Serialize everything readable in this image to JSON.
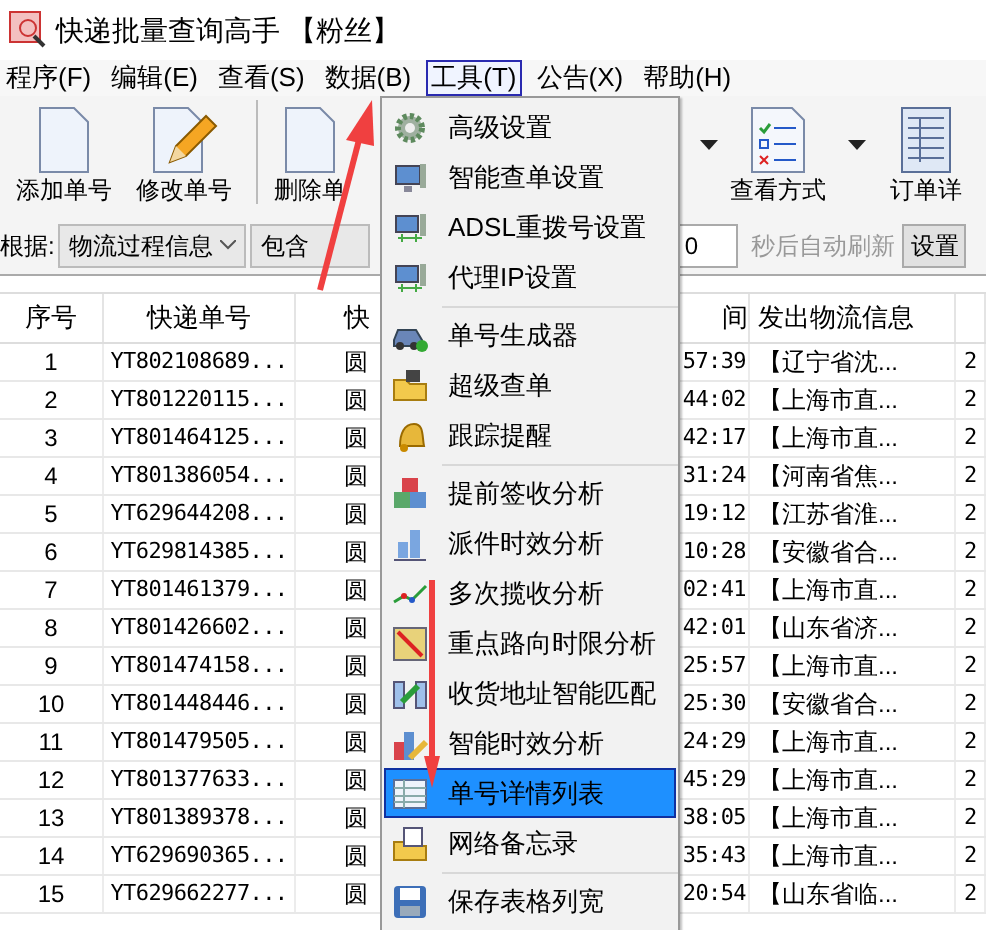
{
  "window": {
    "title": "快递批量查询高手 【粉丝】"
  },
  "menubar": [
    {
      "label": "程序(F)",
      "selected": false
    },
    {
      "label": "编辑(E)",
      "selected": false
    },
    {
      "label": "查看(S)",
      "selected": false
    },
    {
      "label": "数据(B)",
      "selected": false
    },
    {
      "label": "工具(T)",
      "selected": true
    },
    {
      "label": "公告(X)",
      "selected": false
    },
    {
      "label": "帮助(H)",
      "selected": false
    }
  ],
  "toolbar": [
    {
      "kind": "add",
      "label": "添加单号"
    },
    {
      "kind": "edit",
      "label": "修改单号"
    },
    {
      "kind": "sep"
    },
    {
      "kind": "delete",
      "label": "删除单"
    },
    {
      "kind": "caret"
    },
    {
      "kind": "view",
      "label": "查看方式"
    },
    {
      "kind": "caret"
    },
    {
      "kind": "detail",
      "label": "订单详"
    }
  ],
  "filter": {
    "label": "根据:",
    "field": "物流过程信息",
    "match": "包含",
    "seconds": "0",
    "refresh_label": "秒后自动刷新",
    "button": "设置"
  },
  "table": {
    "columns": [
      "序号",
      "快递单号",
      "快",
      "间",
      "发出物流信息",
      ""
    ],
    "rows": [
      [
        "1",
        "YT802108689...",
        "圆",
        "57:39",
        "【辽宁省沈...",
        "2"
      ],
      [
        "2",
        "YT801220115...",
        "圆",
        "44:02",
        "【上海市直...",
        "2"
      ],
      [
        "3",
        "YT801464125...",
        "圆",
        "42:17",
        "【上海市直...",
        "2"
      ],
      [
        "4",
        "YT801386054...",
        "圆",
        "31:24",
        "【河南省焦...",
        "2"
      ],
      [
        "5",
        "YT629644208...",
        "圆",
        "19:12",
        "【江苏省淮...",
        "2"
      ],
      [
        "6",
        "YT629814385...",
        "圆",
        "10:28",
        "【安徽省合...",
        "2"
      ],
      [
        "7",
        "YT801461379...",
        "圆",
        "02:41",
        "【上海市直...",
        "2"
      ],
      [
        "8",
        "YT801426602...",
        "圆",
        "42:01",
        "【山东省济...",
        "2"
      ],
      [
        "9",
        "YT801474158...",
        "圆",
        "25:57",
        "【上海市直...",
        "2"
      ],
      [
        "10",
        "YT801448446...",
        "圆",
        "25:30",
        "【安徽省合...",
        "2"
      ],
      [
        "11",
        "YT801479505...",
        "圆",
        "24:29",
        "【上海市直...",
        "2"
      ],
      [
        "12",
        "YT801377633...",
        "圆",
        "45:29",
        "【上海市直...",
        "2"
      ],
      [
        "13",
        "YT801389378...",
        "圆",
        "38:05",
        "【上海市直...",
        "2"
      ],
      [
        "14",
        "YT629690365...",
        "圆",
        "35:43",
        "【上海市直...",
        "2"
      ],
      [
        "15",
        "YT629662277...",
        "圆",
        "20:54",
        "【山东省临...",
        "2"
      ]
    ]
  },
  "dropdown": {
    "items": [
      {
        "kind": "gear",
        "label": "高级设置",
        "selected": false
      },
      {
        "kind": "monitor",
        "label": "智能查单设置",
        "selected": false
      },
      {
        "kind": "network",
        "label": "ADSL重拨号设置",
        "selected": false
      },
      {
        "kind": "network",
        "label": "代理IP设置",
        "selected": false
      },
      {
        "kind": "separator"
      },
      {
        "kind": "car",
        "label": "单号生成器",
        "selected": false
      },
      {
        "kind": "folder",
        "label": "超级查单",
        "selected": false
      },
      {
        "kind": "bell",
        "label": "跟踪提醒",
        "selected": false
      },
      {
        "kind": "separator"
      },
      {
        "kind": "cubes",
        "label": "提前签收分析",
        "selected": false
      },
      {
        "kind": "bars",
        "label": "派件时效分析",
        "selected": false
      },
      {
        "kind": "line",
        "label": "多次揽收分析",
        "selected": false
      },
      {
        "kind": "map",
        "label": "重点路向时限分析",
        "selected": false
      },
      {
        "kind": "match",
        "label": "收货地址智能匹配",
        "selected": false
      },
      {
        "kind": "chart",
        "label": "智能时效分析",
        "selected": false
      },
      {
        "kind": "list",
        "label": "单号详情列表",
        "selected": true
      },
      {
        "kind": "memo",
        "label": "网络备忘录",
        "selected": false
      },
      {
        "kind": "separator"
      },
      {
        "kind": "save",
        "label": "保存表格列宽",
        "selected": false
      }
    ]
  }
}
